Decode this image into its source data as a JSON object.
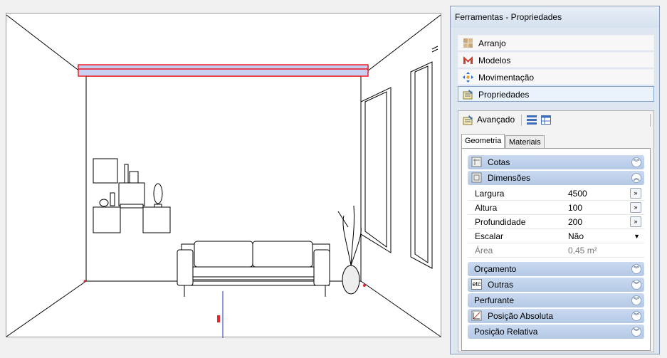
{
  "panel": {
    "title": "Ferramentas - Propriedades",
    "nav": [
      {
        "label": "Arranjo",
        "icon": "arrangement-icon"
      },
      {
        "label": "Modelos",
        "icon": "models-icon"
      },
      {
        "label": "Movimentação",
        "icon": "move-icon"
      },
      {
        "label": "Propriedades",
        "icon": "properties-icon"
      }
    ],
    "active_nav": "Propriedades",
    "advanced": {
      "label": "Avançado",
      "tabs": [
        "Geometria",
        "Materiais"
      ],
      "selected_tab": "Geometria",
      "sections": {
        "cotas": "Cotas",
        "dimensoes": "Dimensões",
        "orcamento": "Orçamento",
        "outras": "Outras",
        "outras_prefix": "etc",
        "perfurante": "Perfurante",
        "posicao_absoluta": "Posição Absoluta",
        "posicao_relativa": "Posição Relativa"
      },
      "properties": [
        {
          "label": "Largura",
          "value": "4500",
          "button": "»"
        },
        {
          "label": "Altura",
          "value": "100",
          "button": "»"
        },
        {
          "label": "Profundidade",
          "value": "200",
          "button": "»"
        },
        {
          "label": "Escalar",
          "value": "Não",
          "dropdown": "▼"
        },
        {
          "label": "Área",
          "value": "0,45 m²"
        }
      ]
    }
  },
  "colors": {
    "selection": "#e8232a",
    "highlight": "#c4cdf0"
  }
}
